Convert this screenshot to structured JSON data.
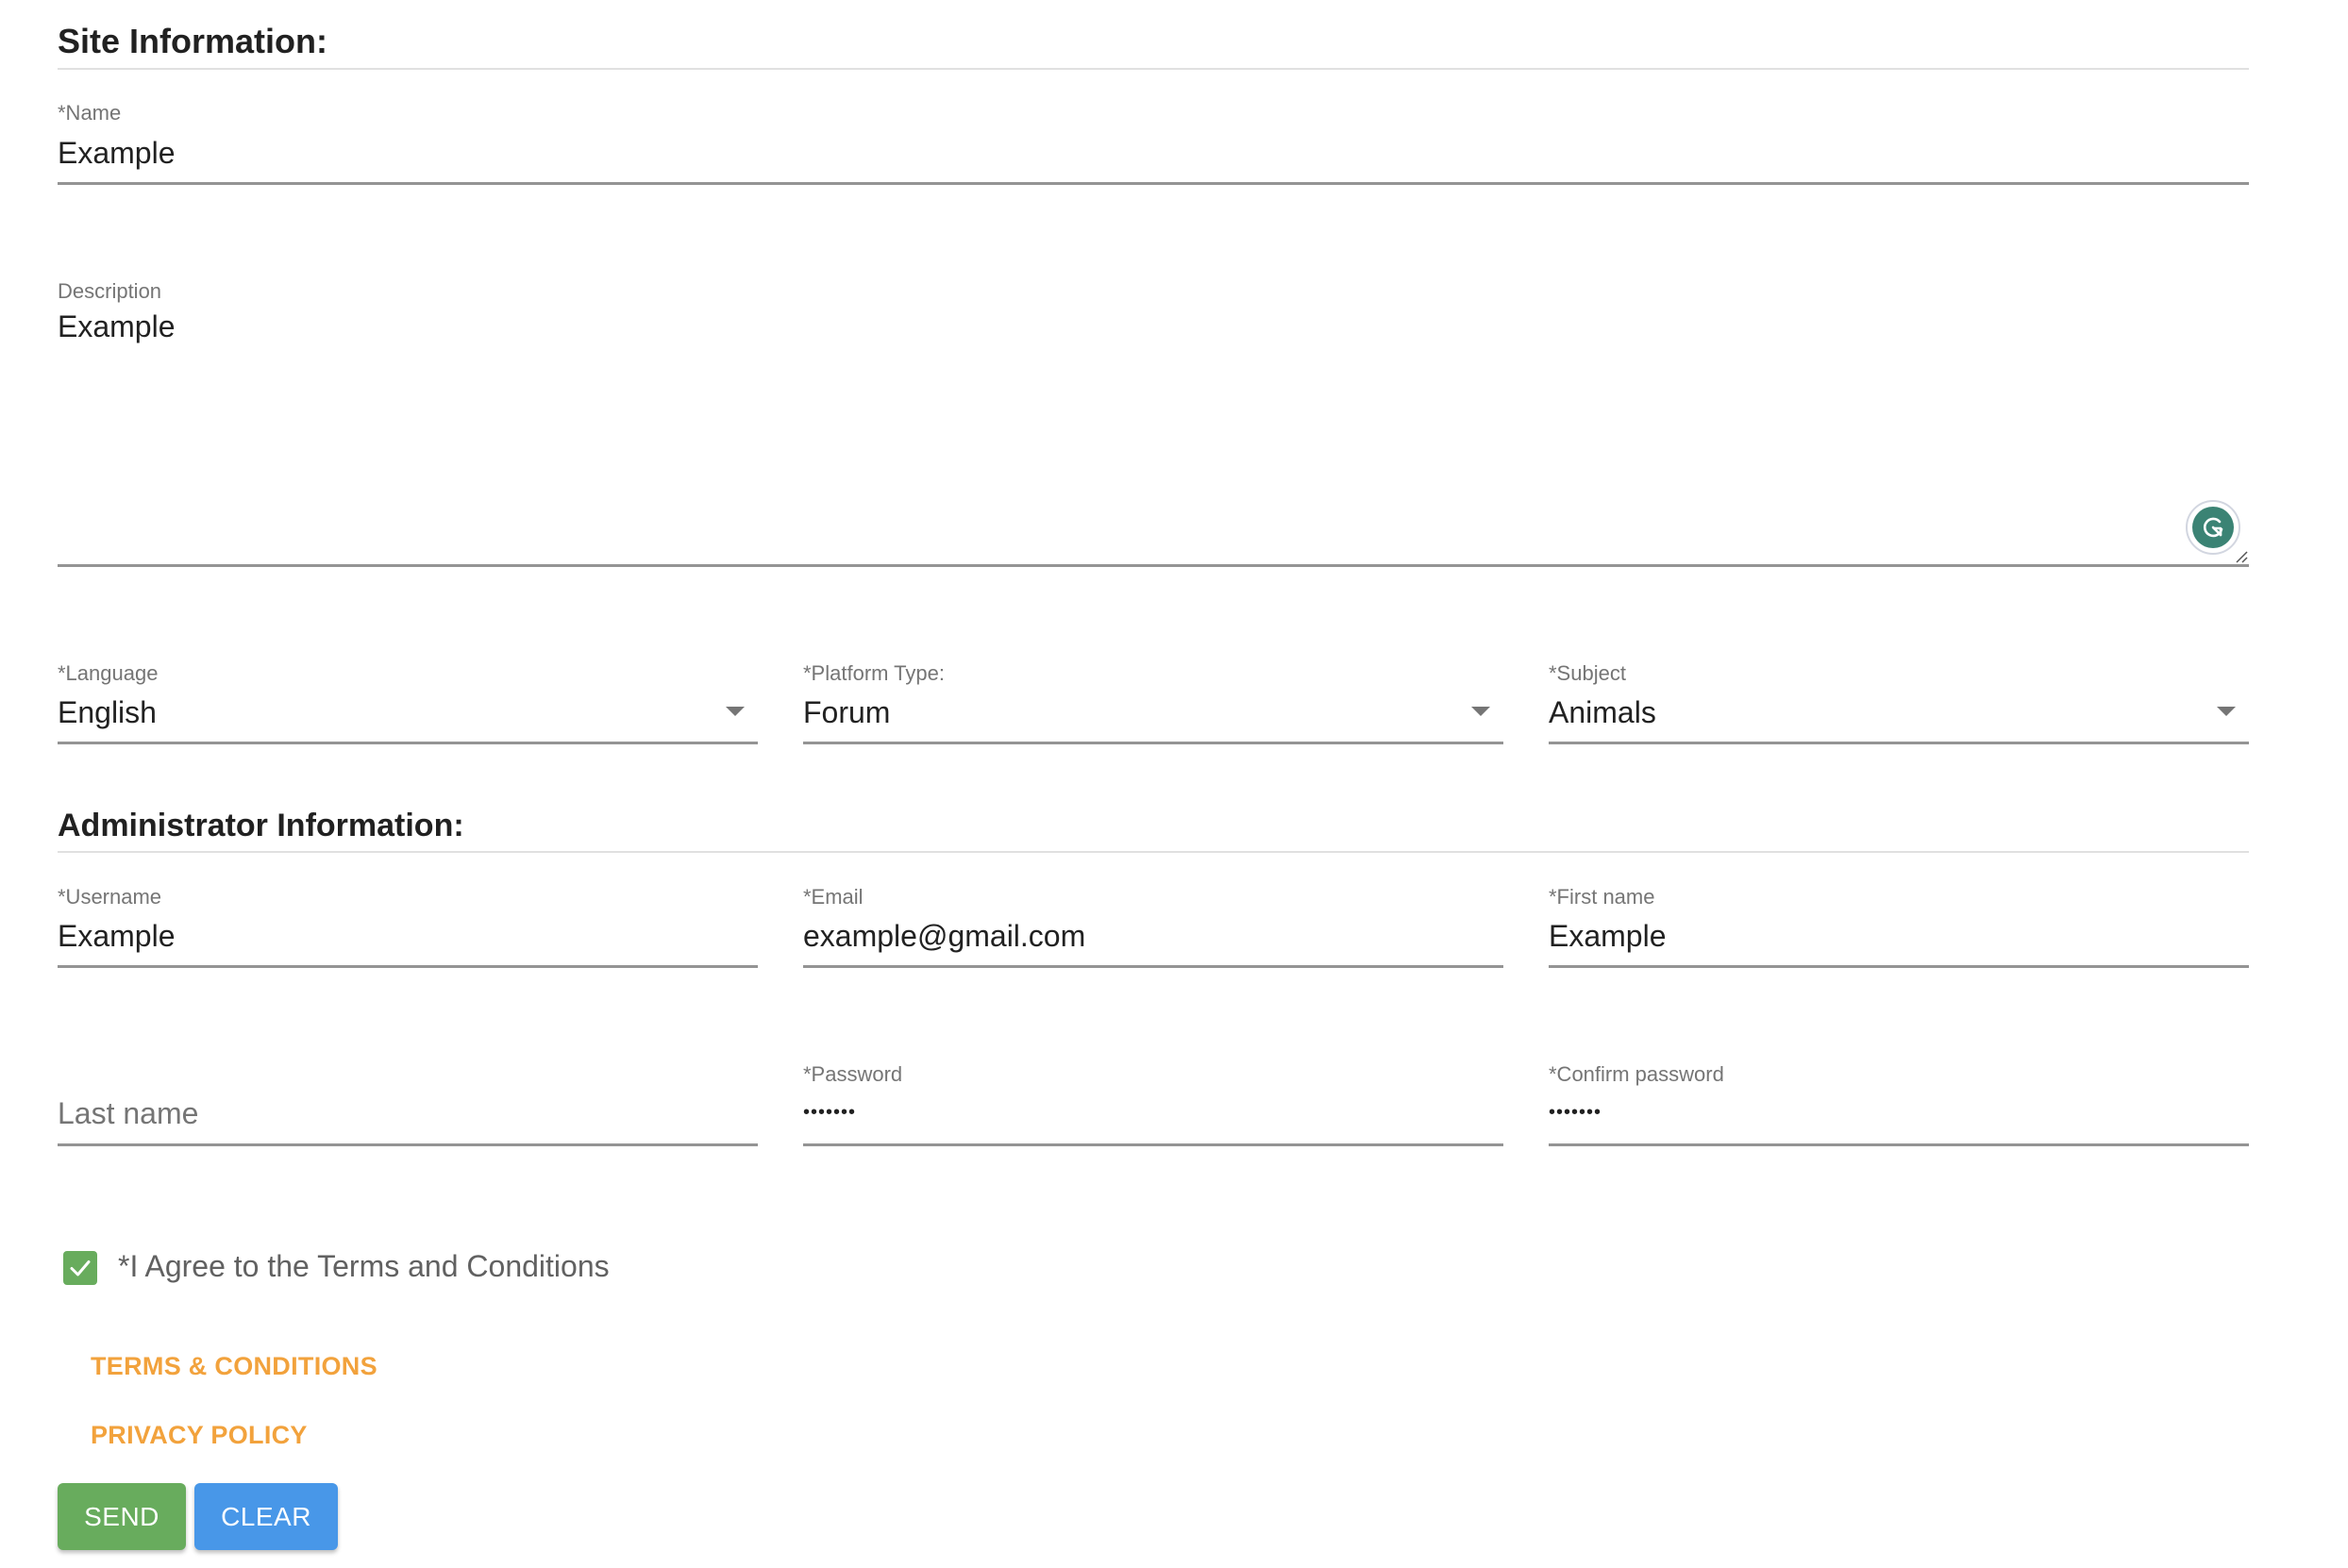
{
  "site_section": {
    "heading": "Site Information:",
    "name": {
      "label": "*Name",
      "value": "Example"
    },
    "description": {
      "label": "Description",
      "value": "Example"
    },
    "language": {
      "label": "*Language",
      "value": "English"
    },
    "platform_type": {
      "label": "*Platform Type:",
      "value": "Forum"
    },
    "subject": {
      "label": "*Subject",
      "value": "Animals"
    }
  },
  "admin_section": {
    "heading": "Administrator Information:",
    "username": {
      "label": "*Username",
      "value": "Example"
    },
    "email": {
      "label": "*Email",
      "value": "example@gmail.com"
    },
    "first_name": {
      "label": "*First name",
      "value": "Example"
    },
    "last_name": {
      "placeholder": "Last name",
      "value": ""
    },
    "password": {
      "label": "*Password",
      "masked_value": "•••••••"
    },
    "confirm_password": {
      "label": "*Confirm password",
      "masked_value": "•••••••"
    }
  },
  "agreement": {
    "label": "*I Agree to the Terms and Conditions",
    "checked": true
  },
  "links": {
    "terms": "TERMS & CONDITIONS",
    "privacy": "PRIVACY POLICY"
  },
  "buttons": {
    "send": "SEND",
    "clear": "CLEAR"
  },
  "icons": {
    "grammarly": "grammarly-icon",
    "dropdown": "caret-down-icon",
    "check": "checkmark-icon",
    "resize": "resize-handle-icon"
  },
  "colors": {
    "send_button": "#68ac5d",
    "clear_button": "#4897e8",
    "link": "#f2a23c",
    "checkbox": "#68ac5d",
    "grammarly": "#3b8374"
  }
}
